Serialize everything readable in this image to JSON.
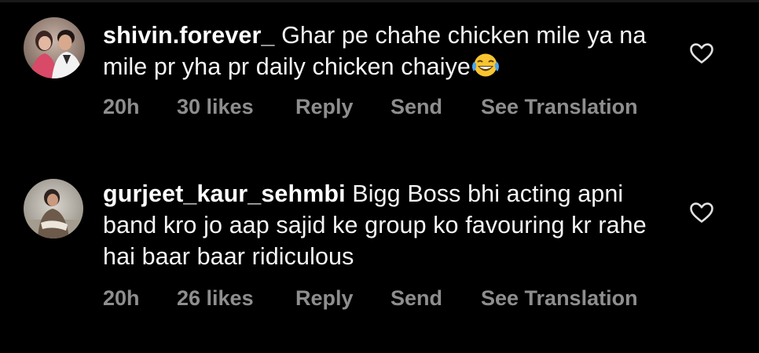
{
  "comments": [
    {
      "username": "shivin.forever_",
      "text": "Ghar pe chahe chicken mile ya na mile pr yha pr daily chicken chaiye",
      "emoji": "face-with-tears-of-joy",
      "time": "20h",
      "likes": "30 likes",
      "reply_label": "Reply",
      "send_label": "Send",
      "translate_label": "See Translation"
    },
    {
      "username": "gurjeet_kaur_sehmbi",
      "text": "Bigg Boss bhi acting apni band kro jo aap sajid ke group ko favouring kr rahe hai baar baar ridiculous",
      "time": "20h",
      "likes": "26 likes",
      "reply_label": "Reply",
      "send_label": "Send",
      "translate_label": "See Translation"
    }
  ],
  "colors": {
    "background": "#000000",
    "text": "#f5f5f5",
    "meta": "#8e8e8e",
    "heart_outline": "#e0e0e0"
  },
  "icons": {
    "like": "heart-outline-icon",
    "emoji": "face-with-tears-of-joy-icon"
  }
}
